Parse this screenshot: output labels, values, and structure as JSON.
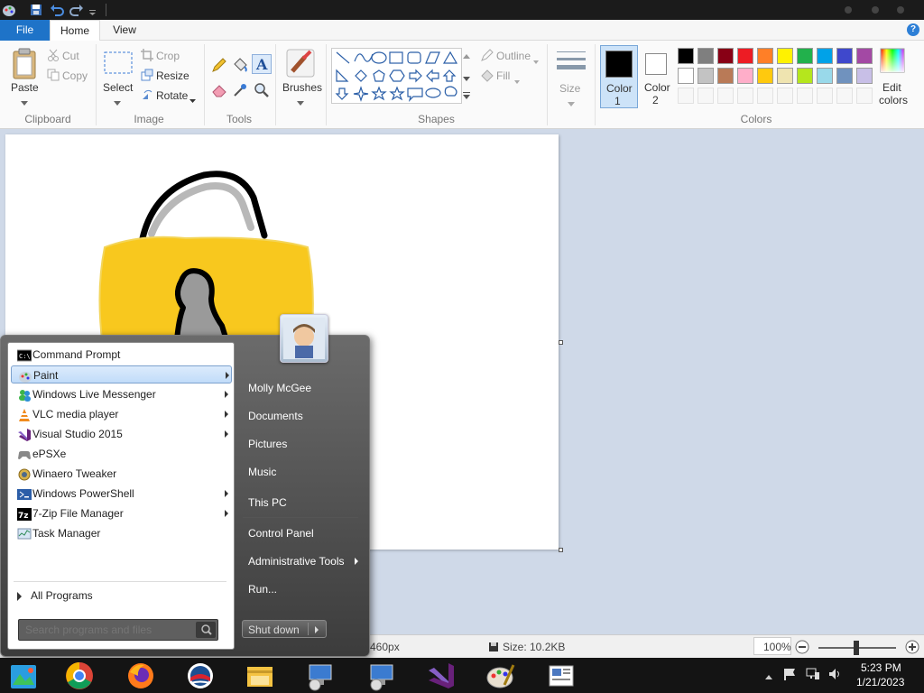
{
  "ribbon": {
    "tabs": [
      "File",
      "Home",
      "View"
    ],
    "clipboard": {
      "paste": "Paste",
      "cut": "Cut",
      "copy": "Copy",
      "group": "Clipboard"
    },
    "image": {
      "select": "Select",
      "crop": "Crop",
      "resize": "Resize",
      "rotate": "Rotate",
      "group": "Image"
    },
    "tools": {
      "group": "Tools"
    },
    "brushes": {
      "label": "Brushes"
    },
    "shapes": {
      "outline": "Outline",
      "fill": "Fill",
      "group": "Shapes"
    },
    "size": {
      "label": "Size"
    },
    "color1": {
      "label1": "Color",
      "label2": "1",
      "value": "#000000"
    },
    "color2": {
      "label1": "Color",
      "label2": "2",
      "value": "#ffffff"
    },
    "colors": {
      "group": "Colors",
      "row1": [
        "#000000",
        "#7f7f7f",
        "#880015",
        "#ed1c24",
        "#ff7f27",
        "#fff200",
        "#22b14c",
        "#00a2e8",
        "#3f48cc",
        "#a349a4"
      ],
      "row2": [
        "#ffffff",
        "#c3c3c3",
        "#b97a57",
        "#ffaec9",
        "#ffc90e",
        "#efe4b0",
        "#b5e61d",
        "#99d9ea",
        "#7092be",
        "#c8bfe7"
      ]
    },
    "edit_colors": {
      "line1": "Edit",
      "line2": "colors"
    }
  },
  "status": {
    "dimensions": "460px",
    "size": "Size: 10.2KB",
    "zoom": "100%"
  },
  "start_menu": {
    "programs": [
      {
        "label": "Command Prompt",
        "arrow": false,
        "icon": "cmd-icon"
      },
      {
        "label": "Paint",
        "arrow": true,
        "icon": "paint-icon"
      },
      {
        "label": "Windows Live Messenger",
        "arrow": true,
        "icon": "messenger-icon"
      },
      {
        "label": "VLC media player",
        "arrow": true,
        "icon": "vlc-icon"
      },
      {
        "label": "Visual Studio 2015",
        "arrow": true,
        "icon": "visual-studio-icon"
      },
      {
        "label": "ePSXe",
        "arrow": false,
        "icon": "gamepad-icon"
      },
      {
        "label": "Winaero Tweaker",
        "arrow": false,
        "icon": "winaero-icon"
      },
      {
        "label": "Windows PowerShell",
        "arrow": true,
        "icon": "powershell-icon"
      },
      {
        "label": "7-Zip File Manager",
        "arrow": true,
        "icon": "7zip-icon"
      },
      {
        "label": "Task Manager",
        "arrow": false,
        "icon": "task-manager-icon"
      }
    ],
    "all_programs": "All Programs",
    "search_placeholder": "Search programs and files",
    "right_links": [
      "Molly McGee",
      "Documents",
      "Pictures",
      "Music",
      "This PC",
      "Control Panel",
      "Administrative Tools",
      "Run..."
    ],
    "shutdown": "Shut down"
  },
  "tray": {
    "time": "5:23 PM",
    "date": "1/21/2023"
  },
  "taskbar": [
    "photo-viewer-icon",
    "chrome-icon",
    "firefox-icon",
    "obama-logo-icon",
    "file-explorer-icon",
    "network-tool-icon",
    "network-tool-icon",
    "visual-studio-icon",
    "paint-icon",
    "document-icon"
  ]
}
